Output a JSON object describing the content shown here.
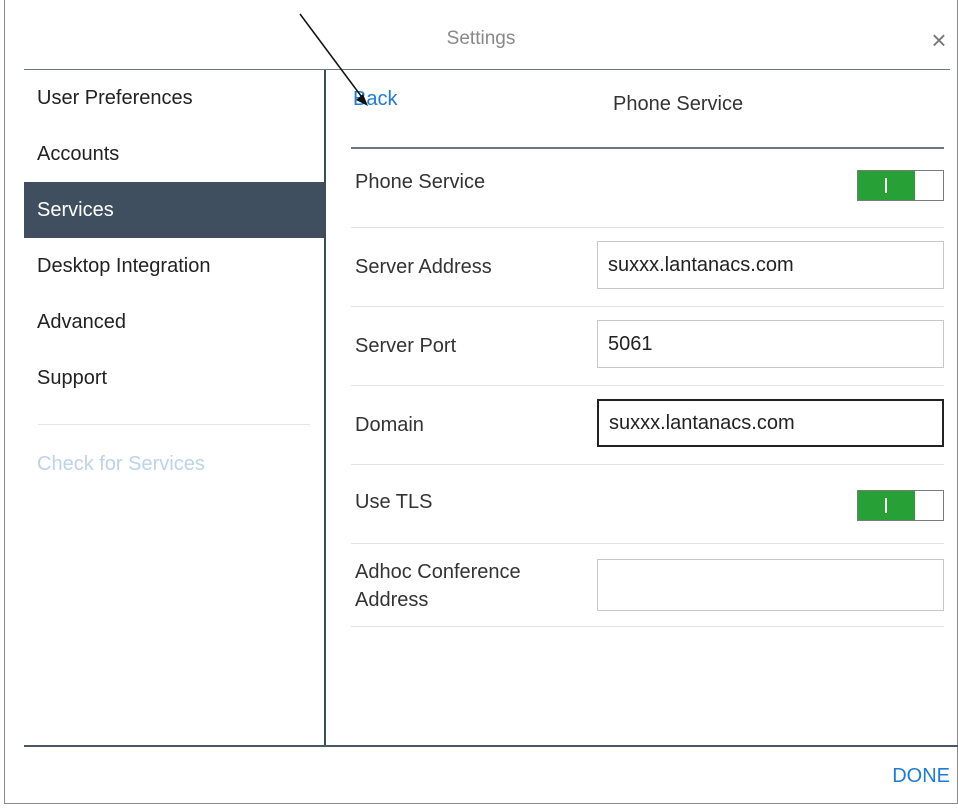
{
  "window": {
    "title": "Settings"
  },
  "sidebar": {
    "items": [
      {
        "label": "User Preferences",
        "active": false
      },
      {
        "label": "Accounts",
        "active": false
      },
      {
        "label": "Services",
        "active": true
      },
      {
        "label": "Desktop Integration",
        "active": false
      },
      {
        "label": "Advanced",
        "active": false
      },
      {
        "label": "Support",
        "active": false
      }
    ],
    "check_link": "Check for Services"
  },
  "content": {
    "back_label": "Back",
    "page_title": "Phone Service",
    "rows": {
      "phone_service": {
        "label": "Phone Service",
        "toggle": "on"
      },
      "server_address": {
        "label": "Server Address",
        "value": "suxxx.lantanacs.com"
      },
      "server_port": {
        "label": "Server Port",
        "value": "5061"
      },
      "domain": {
        "label": "Domain",
        "value": "suxxx.lantanacs.com"
      },
      "use_tls": {
        "label": "Use TLS",
        "toggle": "on"
      },
      "adhoc": {
        "label_line1": "Adhoc Conference",
        "label_line2": "Address",
        "value": ""
      }
    }
  },
  "footer": {
    "done_label": "DONE"
  },
  "colors": {
    "accent_link": "#1e7bd6",
    "sidebar_active": "#3f4f5f",
    "toggle_on": "#27a135"
  },
  "icons": {
    "close": "close-icon",
    "annotation": "annotation-arrow-icon"
  }
}
